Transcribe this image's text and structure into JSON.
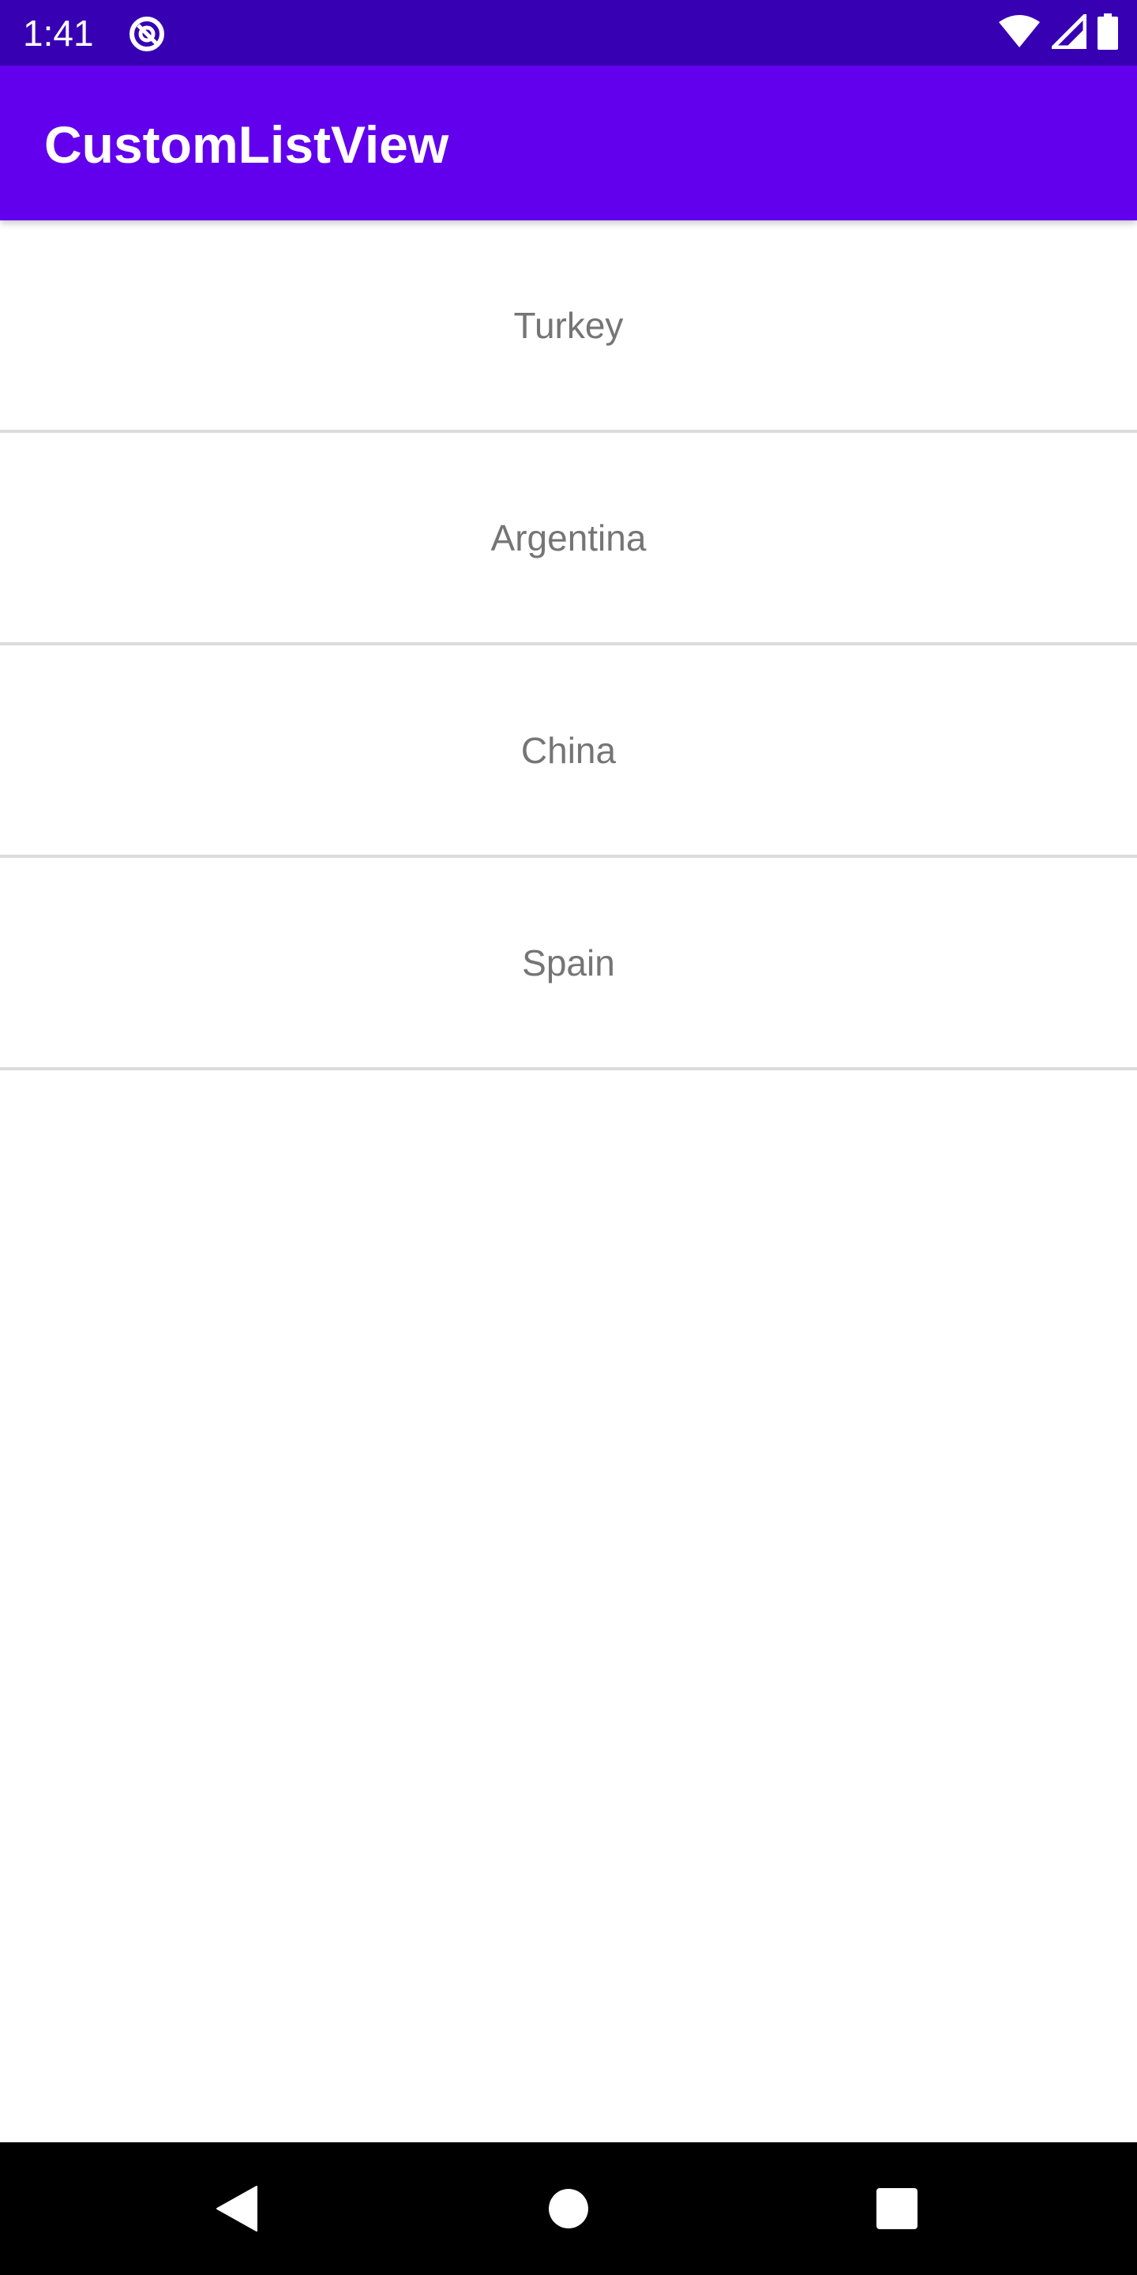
{
  "status_bar": {
    "time": "1:41",
    "icons": [
      "data-saver-icon",
      "wifi-icon",
      "cellular-signal-icon",
      "battery-icon"
    ]
  },
  "app_bar": {
    "title": "CustomListView",
    "color": "#6200ee"
  },
  "list": {
    "items": [
      {
        "label": "Turkey"
      },
      {
        "label": "Argentina"
      },
      {
        "label": "China"
      },
      {
        "label": "Spain"
      }
    ]
  },
  "nav_bar": {
    "buttons": [
      "back-icon",
      "home-icon",
      "recents-icon"
    ]
  },
  "colors": {
    "status_bar": "#3700b3",
    "app_bar": "#6200ee",
    "item_text": "#757575",
    "divider": "#dcdcdc"
  }
}
